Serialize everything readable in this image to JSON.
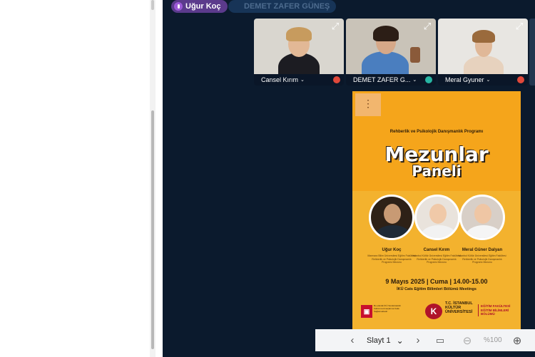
{
  "meeting": {
    "active_speaker": "Uğur Koç",
    "other_speaker": "DEMET ZAFER GÜNEŞ",
    "participants": [
      {
        "name": "Cansel Kırım",
        "status": "muted"
      },
      {
        "name": "DEMET ZAFER G...",
        "status": "speaking"
      },
      {
        "name": "Meral Gyuner",
        "status": "muted"
      }
    ],
    "colors": {
      "background": "#0b1a2d",
      "speaker_chip": "#5b3a8c",
      "muted": "#e0483a",
      "live": "#27b5a3"
    }
  },
  "poster": {
    "menu_icon": "⋮",
    "program": "Rehberlik ve Psikolojik Danışmanlık Programı",
    "title_line1": "Mezunlar",
    "title_line2": "Paneli",
    "panelists": [
      {
        "name": "Uğur Koç",
        "desc": "Marmara Bilim Üniversitesi Eğitim Fakültesi Rehberlik ve Psikolojik Danışmanlık Programı Mezunu"
      },
      {
        "name": "Cansel Kırım",
        "desc": "İstanbul Kültür Üniversitesi Eğitim Fakültesi Rehberlik ve Psikolojik Danışmanlık Programı Mezunu"
      },
      {
        "name": "Meral Güner Dalyan",
        "desc": "İstanbul Kültür Üniversitesi Eğitim Fakültesi Rehberlik ve Psikolojik Danışmanlık Programı Mezunu"
      }
    ],
    "date": "9 Mayıs 2025 | Cuma | 14.00-15.00",
    "venue": "İKÜ Cats Eğitim Bilimleri Bölümü Meetings",
    "logo_left_text": "Bu etkinlik İKÜ Sürdürülebilir Kalkınma Amaçlarına Katkı Sağlamaktadır",
    "logo_k_letter": "K",
    "university": "T.C. İSTANBUL KÜLTÜR ÜNİVERSİTESİ",
    "faculty": "EĞİTİM FAKÜLTESİ EĞİTİM BİLİMLERİ BÖLÜMÜ"
  },
  "toolbar": {
    "prev_icon": "‹",
    "slide_label": "Slayt 1",
    "dropdown_icon": "⌄",
    "next_icon": "›",
    "image_icon": "▭",
    "zoom_out_icon": "⊖",
    "zoom_level": "%100",
    "zoom_in_icon": "⊕"
  }
}
